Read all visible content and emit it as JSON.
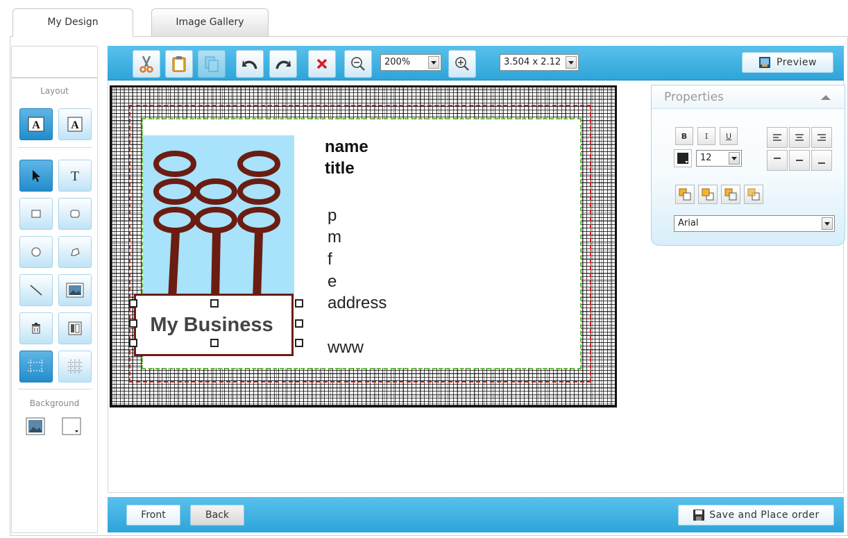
{
  "tabs": [
    {
      "label": "My Design",
      "active": true
    },
    {
      "label": "Image Gallery",
      "active": false
    }
  ],
  "toolbar": {
    "buttons": [
      "cut-icon",
      "paste-icon",
      "copy-icon",
      "undo-icon",
      "redo-icon",
      "delete-icon",
      "zoom-out-icon",
      "zoom-in-icon"
    ],
    "zoom_value": "200%",
    "size_value": "3.504 x 2.12",
    "preview_label": "Preview"
  },
  "left_panel": {
    "layout_heading": "Layout",
    "background_heading": "Background",
    "tools": [
      "text-layout-front-icon",
      "text-layout-back-icon",
      "select-arrow-icon",
      "text-tool-icon",
      "rectangle-icon",
      "rounded-rectangle-icon",
      "ellipse-icon",
      "freeform-shape-icon",
      "line-icon",
      "image-icon",
      "delete-object-icon",
      "align-icon",
      "crop-guides-icon",
      "grid-icon"
    ],
    "selected_tools": [
      "text-layout-front-icon",
      "select-arrow-icon",
      "crop-guides-icon"
    ]
  },
  "card": {
    "business_name": "My Business",
    "name": "name",
    "title": "title",
    "phone": "p",
    "mobile": "m",
    "fax": "f",
    "email": "e",
    "address": "address",
    "website": "www"
  },
  "properties": {
    "heading": "Properties",
    "bold": "B",
    "italic": "I",
    "underline": "U",
    "font_size": "12",
    "font_family": "Arial"
  },
  "bottom": {
    "front_label": "Front",
    "back_label": "Back",
    "save_label": "Save and Place order"
  },
  "colors": {
    "toolbar_blue": "#2ea4d9",
    "logo_bg": "#a8e2fb",
    "logo_brown": "#6b1d12",
    "bleed_red": "#cc2222",
    "safe_green": "#66bb33"
  }
}
